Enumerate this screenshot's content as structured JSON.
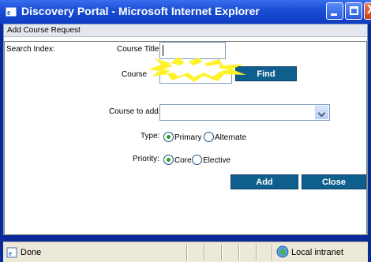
{
  "window": {
    "title": "Discovery Portal - Microsoft Internet Explorer",
    "close_glyph": "X"
  },
  "header": {
    "title": "Add Course Request"
  },
  "form": {
    "search_index_label": "Search Index:",
    "course_title_label": "Course Title:",
    "course_title_value": "",
    "course_label": "Course",
    "find_label": "Find",
    "course_to_add_label": "Course to add:",
    "course_to_add_value": "",
    "type_label": "Type:",
    "type_options": [
      "Primary",
      "Alternate"
    ],
    "type_selected": "Primary",
    "priority_label": "Priority:",
    "priority_options": [
      "Core",
      "Elective"
    ],
    "priority_selected": "Core",
    "add_label": "Add",
    "close_label": "Close"
  },
  "statusbar": {
    "status": "Done",
    "zone": "Local intranet"
  },
  "colors": {
    "titlebar": "#1b4fd6",
    "button": "#0f5f8e",
    "radio_check": "#21a121"
  }
}
